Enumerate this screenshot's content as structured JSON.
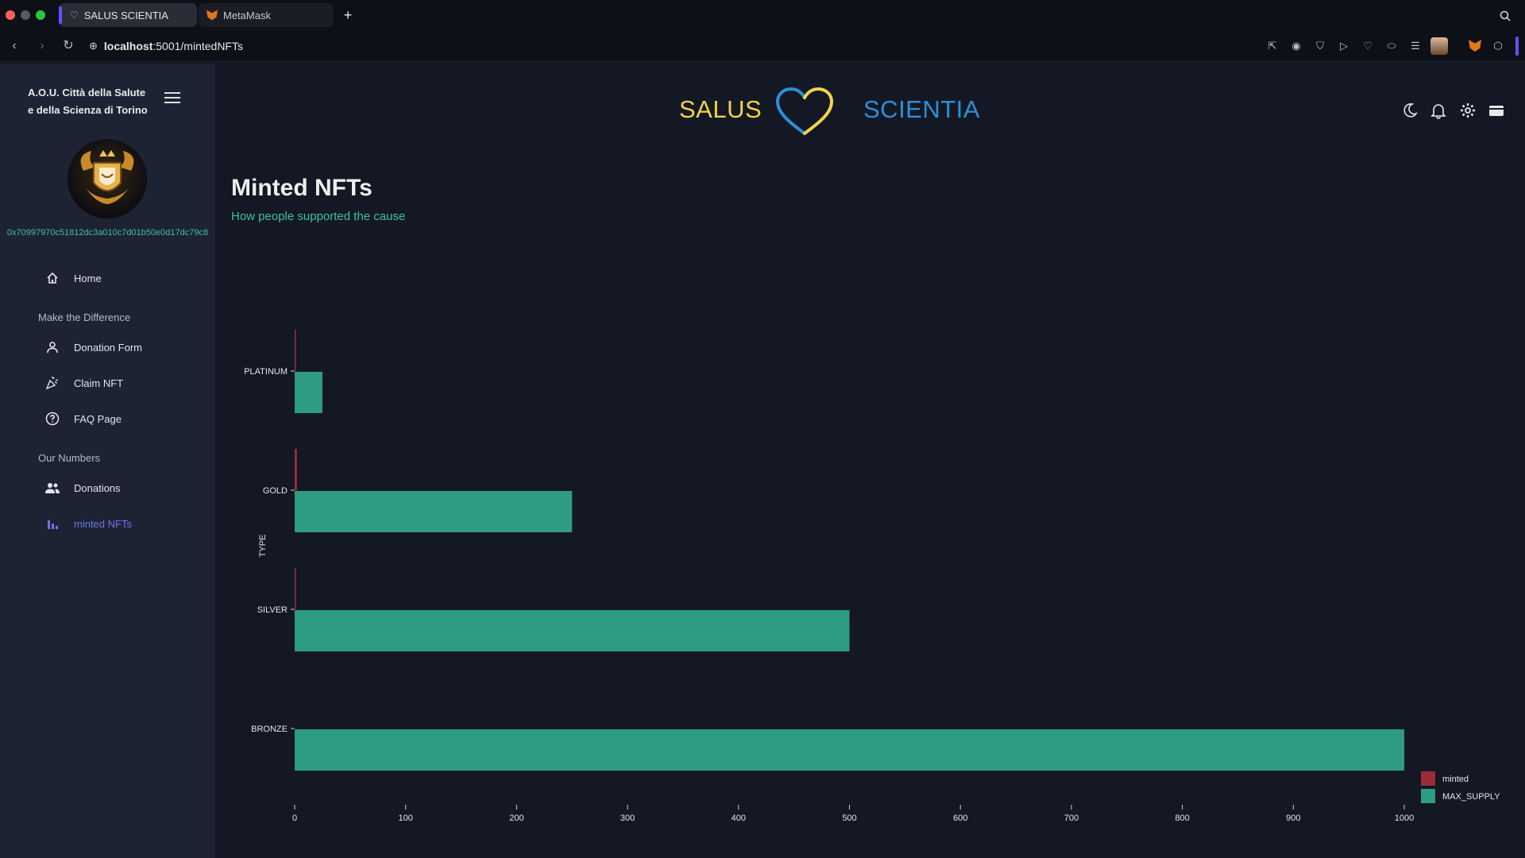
{
  "browser": {
    "tabs": [
      {
        "label": "SALUS SCIENTIA",
        "active": true
      },
      {
        "label": "MetaMask",
        "active": false
      }
    ],
    "url_host": "localhost",
    "url_path": ":5001/mintedNFTs"
  },
  "sidebar": {
    "org_line1": "A.O.U. Città della Salute",
    "org_line2": "e della Scienza di Torino",
    "wallet": "0x70997970c51812dc3a010c7d01b50e0d17dc79c8",
    "home": "Home",
    "section1": "Make the Difference",
    "items1": [
      "Donation Form",
      "Claim NFT",
      "FAQ Page"
    ],
    "section2": "Our Numbers",
    "items2": [
      "Donations",
      "minted NFTs"
    ]
  },
  "header": {
    "brand_left": "SALUS",
    "brand_right": "SCIENTIA"
  },
  "page": {
    "title": "Minted NFTs",
    "subtitle": "How people supported the cause"
  },
  "colors": {
    "minted": "#9b2d3a",
    "max_supply": "#2e9c83",
    "accent_green": "#3fbfa5",
    "brand_yellow": "#f1d34a",
    "brand_blue": "#2d8fd8"
  },
  "chart_data": {
    "type": "bar",
    "orientation": "horizontal",
    "categories": [
      "PLATINUM",
      "GOLD",
      "SILVER",
      "BRONZE"
    ],
    "series": [
      {
        "name": "minted",
        "values": [
          1,
          2,
          1,
          0
        ]
      },
      {
        "name": "MAX_SUPPLY",
        "values": [
          25,
          250,
          500,
          1000
        ]
      }
    ],
    "ylabel": "TYPE",
    "xlabel": "",
    "xlim": [
      0,
      1000
    ],
    "xticks": [
      0,
      100,
      200,
      300,
      400,
      500,
      600,
      700,
      800,
      900,
      1000
    ],
    "legend": "bottom-right",
    "grid": false
  }
}
